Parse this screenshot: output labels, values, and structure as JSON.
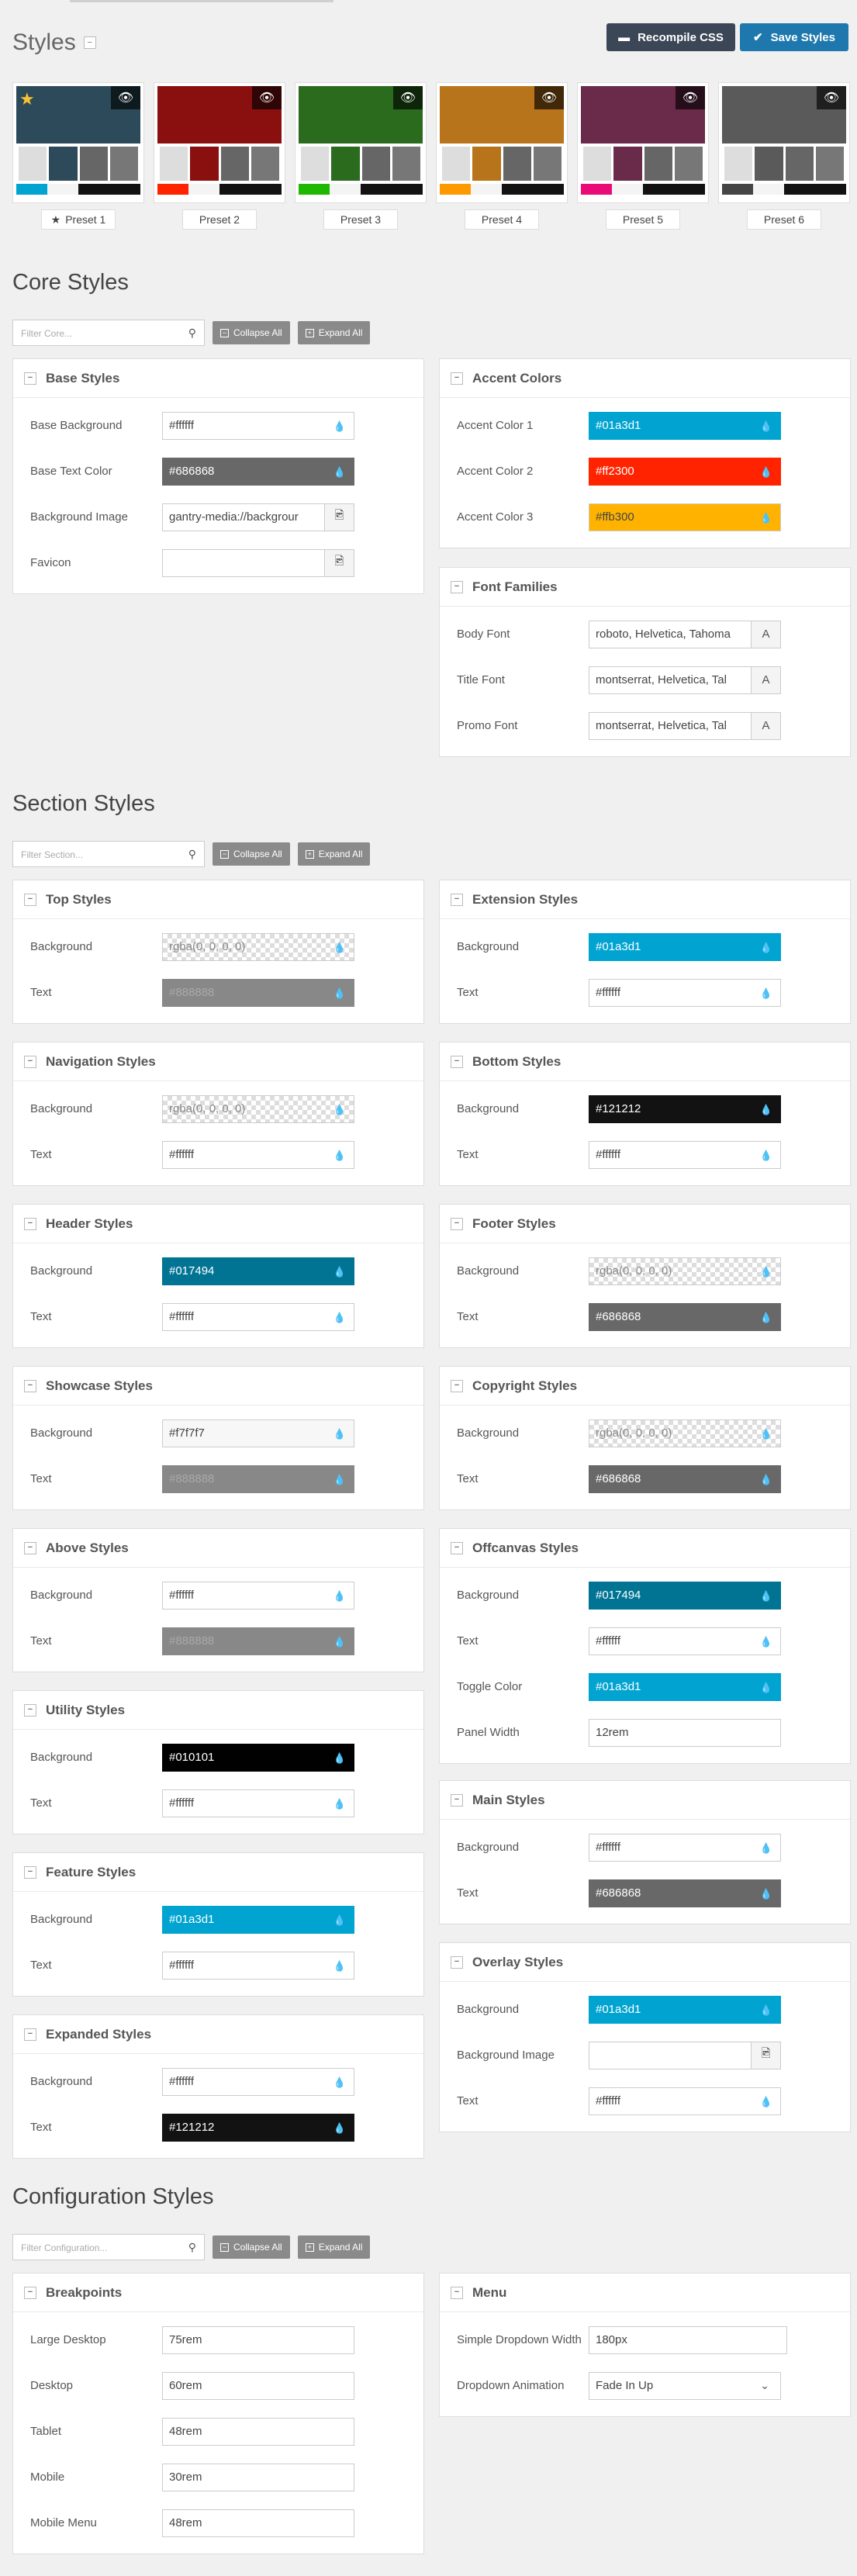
{
  "page": {
    "title": "Styles"
  },
  "header": {
    "recompile_label": "Recompile CSS",
    "save_label": "Save Styles"
  },
  "presets": [
    {
      "label": "Preset 1",
      "starred": true,
      "hero": "#2d4a5a",
      "colors": [
        "#01a3d1",
        "#f4f4f4",
        "#121212",
        "#121212"
      ]
    },
    {
      "label": "Preset 2",
      "starred": false,
      "hero": "#8a1010",
      "colors": [
        "#ff2300",
        "#f4f4f4",
        "#121212",
        "#121212"
      ]
    },
    {
      "label": "Preset 3",
      "starred": false,
      "hero": "#2a6b1e",
      "colors": [
        "#1fb800",
        "#f4f4f4",
        "#121212",
        "#121212"
      ]
    },
    {
      "label": "Preset 4",
      "starred": false,
      "hero": "#b8741a",
      "colors": [
        "#ff9900",
        "#f4f4f4",
        "#121212",
        "#121212"
      ]
    },
    {
      "label": "Preset 5",
      "starred": false,
      "hero": "#6a2a4a",
      "colors": [
        "#ea0c76",
        "#f4f4f4",
        "#121212",
        "#121212"
      ]
    },
    {
      "label": "Preset 6",
      "starred": false,
      "hero": "#5a5a5a",
      "colors": [
        "#454545",
        "#f4f4f4",
        "#121212",
        "#121212"
      ]
    }
  ],
  "common": {
    "collapse_all": "Collapse All",
    "expand_all": "Expand All"
  },
  "core": {
    "title": "Core Styles",
    "filter_placeholder": "Filter Core...",
    "base": {
      "title": "Base Styles",
      "rows": [
        {
          "label": "Base Background",
          "value": "#ffffff",
          "kind": "color",
          "bg": "#ffffff"
        },
        {
          "label": "Base Text Color",
          "value": "#686868",
          "kind": "color",
          "bg": "#686868"
        },
        {
          "label": "Background Image",
          "value": "gantry-media://backgrour",
          "kind": "image"
        },
        {
          "label": "Favicon",
          "value": "",
          "kind": "image"
        }
      ]
    },
    "accent": {
      "title": "Accent Colors",
      "rows": [
        {
          "label": "Accent Color 1",
          "value": "#01a3d1",
          "kind": "color",
          "bg": "#01a3d1"
        },
        {
          "label": "Accent Color 2",
          "value": "#ff2300",
          "kind": "color",
          "bg": "#ff2300"
        },
        {
          "label": "Accent Color 3",
          "value": "#ffb300",
          "kind": "color",
          "bg": "#ffb300"
        }
      ]
    },
    "fonts": {
      "title": "Font Families",
      "rows": [
        {
          "label": "Body Font",
          "value": "roboto, Helvetica, Tahoma",
          "kind": "font"
        },
        {
          "label": "Title Font",
          "value": "montserrat, Helvetica, Tal",
          "kind": "font"
        },
        {
          "label": "Promo Font",
          "value": "montserrat, Helvetica, Tal",
          "kind": "font"
        }
      ]
    }
  },
  "section": {
    "title": "Section Styles",
    "filter_placeholder": "Filter Section...",
    "top": {
      "title": "Top Styles",
      "rows": [
        {
          "label": "Background",
          "value": "rgba(0, 0, 0, 0)",
          "kind": "color",
          "bg": "transparent"
        },
        {
          "label": "Text",
          "value": "#888888",
          "kind": "color",
          "bg": "#888888"
        }
      ]
    },
    "extension": {
      "title": "Extension Styles",
      "rows": [
        {
          "label": "Background",
          "value": "#01a3d1",
          "kind": "color",
          "bg": "#01a3d1"
        },
        {
          "label": "Text",
          "value": "#ffffff",
          "kind": "color",
          "bg": "#ffffff"
        }
      ]
    },
    "navigation": {
      "title": "Navigation Styles",
      "rows": [
        {
          "label": "Background",
          "value": "rgba(0, 0, 0, 0)",
          "kind": "color",
          "bg": "transparent"
        },
        {
          "label": "Text",
          "value": "#ffffff",
          "kind": "color",
          "bg": "#ffffff"
        }
      ]
    },
    "bottom": {
      "title": "Bottom Styles",
      "rows": [
        {
          "label": "Background",
          "value": "#121212",
          "kind": "color",
          "bg": "#121212"
        },
        {
          "label": "Text",
          "value": "#ffffff",
          "kind": "color",
          "bg": "#ffffff"
        }
      ]
    },
    "header": {
      "title": "Header Styles",
      "rows": [
        {
          "label": "Background",
          "value": "#017494",
          "kind": "color",
          "bg": "#017494"
        },
        {
          "label": "Text",
          "value": "#ffffff",
          "kind": "color",
          "bg": "#ffffff"
        }
      ]
    },
    "footer": {
      "title": "Footer Styles",
      "rows": [
        {
          "label": "Background",
          "value": "rgba(0, 0, 0, 0)",
          "kind": "color",
          "bg": "transparent"
        },
        {
          "label": "Text",
          "value": "#686868",
          "kind": "color",
          "bg": "#686868"
        }
      ]
    },
    "showcase": {
      "title": "Showcase Styles",
      "rows": [
        {
          "label": "Background",
          "value": "#f7f7f7",
          "kind": "color",
          "bg": "#f7f7f7"
        },
        {
          "label": "Text",
          "value": "#888888",
          "kind": "color",
          "bg": "#888888"
        }
      ]
    },
    "copyright": {
      "title": "Copyright Styles",
      "rows": [
        {
          "label": "Background",
          "value": "rgba(0, 0, 0, 0)",
          "kind": "color",
          "bg": "transparent"
        },
        {
          "label": "Text",
          "value": "#686868",
          "kind": "color",
          "bg": "#686868"
        }
      ]
    },
    "above": {
      "title": "Above Styles",
      "rows": [
        {
          "label": "Background",
          "value": "#ffffff",
          "kind": "color",
          "bg": "#ffffff"
        },
        {
          "label": "Text",
          "value": "#888888",
          "kind": "color",
          "bg": "#888888"
        }
      ]
    },
    "offcanvas": {
      "title": "Offcanvas Styles",
      "rows": [
        {
          "label": "Background",
          "value": "#017494",
          "kind": "color",
          "bg": "#017494"
        },
        {
          "label": "Text",
          "value": "#ffffff",
          "kind": "color",
          "bg": "#ffffff"
        },
        {
          "label": "Toggle Color",
          "value": "#01a3d1",
          "kind": "color",
          "bg": "#01a3d1"
        },
        {
          "label": "Panel Width",
          "value": "12rem",
          "kind": "text"
        }
      ]
    },
    "utility": {
      "title": "Utility Styles",
      "rows": [
        {
          "label": "Background",
          "value": "#010101",
          "kind": "color",
          "bg": "#010101"
        },
        {
          "label": "Text",
          "value": "#ffffff",
          "kind": "color",
          "bg": "#ffffff"
        }
      ]
    },
    "main": {
      "title": "Main Styles",
      "rows": [
        {
          "label": "Background",
          "value": "#ffffff",
          "kind": "color",
          "bg": "#ffffff"
        },
        {
          "label": "Text",
          "value": "#686868",
          "kind": "color",
          "bg": "#686868"
        }
      ]
    },
    "feature": {
      "title": "Feature Styles",
      "rows": [
        {
          "label": "Background",
          "value": "#01a3d1",
          "kind": "color",
          "bg": "#01a3d1"
        },
        {
          "label": "Text",
          "value": "#ffffff",
          "kind": "color",
          "bg": "#ffffff"
        }
      ]
    },
    "overlay": {
      "title": "Overlay Styles",
      "rows": [
        {
          "label": "Background",
          "value": "#01a3d1",
          "kind": "color",
          "bg": "#01a3d1"
        },
        {
          "label": "Background Image",
          "value": "",
          "kind": "image"
        },
        {
          "label": "Text",
          "value": "#ffffff",
          "kind": "color",
          "bg": "#ffffff"
        }
      ]
    },
    "expanded": {
      "title": "Expanded Styles",
      "rows": [
        {
          "label": "Background",
          "value": "#ffffff",
          "kind": "color",
          "bg": "#ffffff"
        },
        {
          "label": "Text",
          "value": "#121212",
          "kind": "color",
          "bg": "#121212"
        }
      ]
    }
  },
  "config": {
    "title": "Configuration Styles",
    "filter_placeholder": "Filter Configuration...",
    "breakpoints": {
      "title": "Breakpoints",
      "rows": [
        {
          "label": "Large Desktop",
          "value": "75rem",
          "kind": "text"
        },
        {
          "label": "Desktop",
          "value": "60rem",
          "kind": "text"
        },
        {
          "label": "Tablet",
          "value": "48rem",
          "kind": "text"
        },
        {
          "label": "Mobile",
          "value": "30rem",
          "kind": "text"
        },
        {
          "label": "Mobile Menu",
          "value": "48rem",
          "kind": "text"
        }
      ]
    },
    "menu": {
      "title": "Menu",
      "rows": [
        {
          "label": "Simple Dropdown Width",
          "value": "180px",
          "kind": "text"
        },
        {
          "label": "Dropdown Animation",
          "value": "Fade In Up",
          "kind": "select"
        }
      ]
    }
  }
}
